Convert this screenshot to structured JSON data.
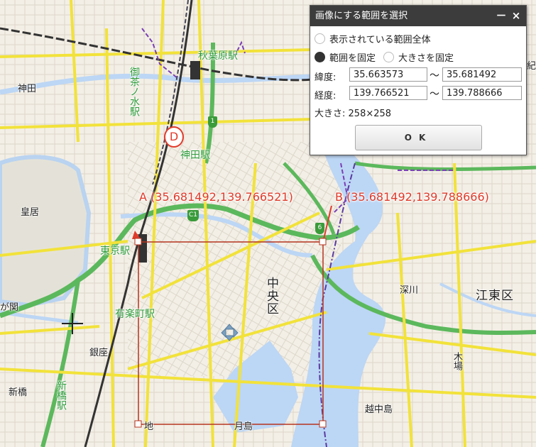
{
  "dialog": {
    "title": "画像にする範囲を選択",
    "minimize_label": "－",
    "close_label": "×",
    "radio_options": [
      {
        "label": "表示されている範囲全体",
        "selected": false
      },
      {
        "label": "範囲を固定",
        "selected": true
      },
      {
        "label": "大きさを固定",
        "selected": false
      }
    ],
    "latitude": {
      "label": "緯度:",
      "from": "35.663573",
      "to": "35.681492"
    },
    "longitude": {
      "label": "経度:",
      "from": "139.766521",
      "to": "139.788666"
    },
    "range_sep": "〜",
    "size": {
      "label": "大きさ:",
      "value": "258×258"
    },
    "ok_label": "OK"
  },
  "map": {
    "point_a_label": "A (35.681492,139.766521)",
    "point_b_label": "B (35.681492,139.788666)",
    "marker_d": "D",
    "places": {
      "akihabara": "秋葉原駅",
      "ochanomizu": "御茶ノ水駅",
      "kanda": "神田",
      "kanda_station": "神田駅",
      "kokyo": "皇居",
      "tokyo_station": "東京駅",
      "yurakucho": "有楽町駅",
      "kasumigaseki": "が関",
      "ginza": "銀座",
      "shinbashi": "新橋",
      "shinbashi_station": "新橋駅",
      "chuo_ku": "中央区",
      "fukagawa": "深川",
      "koto_ku": "江東区",
      "kiba": "木場",
      "etchujima": "越中島",
      "tsukishima": "月島",
      "chi": "地",
      "kuramae": "紀"
    },
    "route_shields": [
      "1",
      "C1",
      "6"
    ],
    "colors": {
      "selection": "#b5341f",
      "label_red": "#e03a2a",
      "road_yellow": "#f2e23a",
      "road_green": "#5cb85c",
      "water": "#bcd6f5"
    }
  }
}
